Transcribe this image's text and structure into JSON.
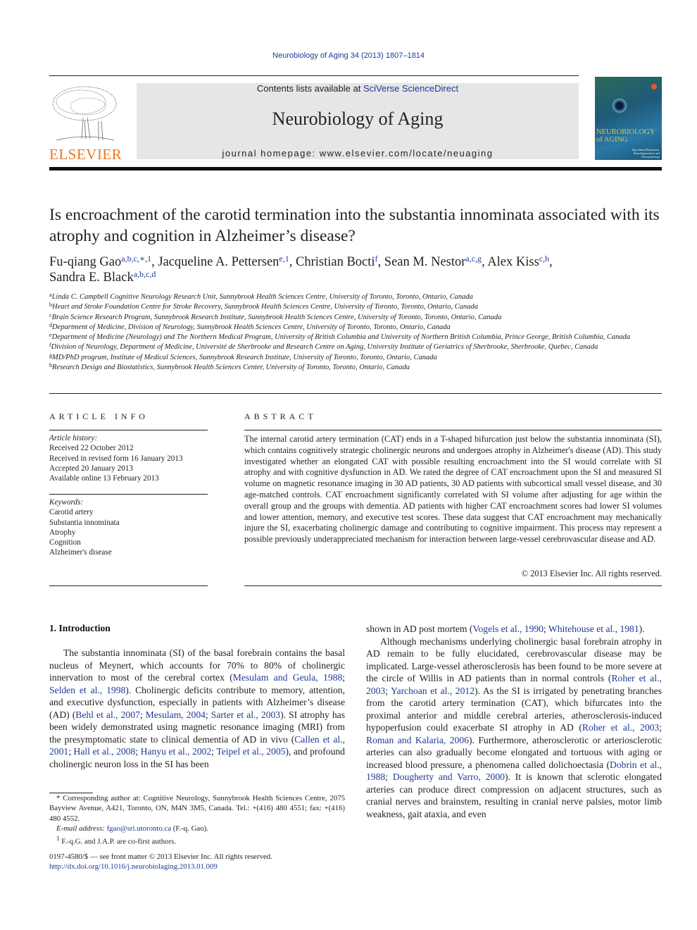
{
  "header": {
    "running_head": "Neurobiology of Aging 34 (2013) 1807–1814",
    "contents_prefix": "Contents lists available at ",
    "contents_link": "SciVerse ScienceDirect",
    "journal_title": "Neurobiology of Aging",
    "homepage": "journal homepage: www.elsevier.com/locate/neuaging",
    "publisher_logo_text": "ELSEVIER",
    "cover_title_line1": "NEUROBIOLOGY",
    "cover_title_line2": "of AGING",
    "cover_subtitle": "Age-related Phenomena, Neurodegeneration and Neuropathology"
  },
  "article": {
    "title": "Is encroachment of the carotid termination into the substantia innominata associated with its atrophy and cognition in Alzheimer’s disease?",
    "authors": [
      {
        "name": "Fu-qiang Gao",
        "sup": "a,b,c,∗,1",
        "sep": ", "
      },
      {
        "name": "Jacqueline A. Pettersen",
        "sup": "e,1",
        "sep": ", "
      },
      {
        "name": "Christian Bocti",
        "sup": "f",
        "sep": ", "
      },
      {
        "name": "Sean M. Nestor",
        "sup": "a,c,g",
        "sep": ", "
      },
      {
        "name": "Alex Kiss",
        "sup": "c,h",
        "sep": ","
      },
      {
        "name": "Sandra E. Black",
        "sup": "a,b,c,d",
        "sep": ""
      }
    ],
    "affiliations": [
      {
        "key": "a",
        "text": "Linda C. Campbell Cognitive Neurology Research Unit, Sunnybrook Health Sciences Centre, University of Toronto, Toronto, Ontario, Canada"
      },
      {
        "key": "b",
        "text": "Heart and Stroke Foundation Centre for Stroke Recovery, Sunnybrook Health Sciences Centre, University of Toronto, Toronto, Ontario, Canada"
      },
      {
        "key": "c",
        "text": "Brain Science Research Program, Sunnybrook Research Institute, Sunnybrook Health Sciences Centre, University of Toronto, Toronto, Ontario, Canada"
      },
      {
        "key": "d",
        "text": "Department of Medicine, Division of Neurology, Sunnybrook Health Sciences Centre, University of Toronto, Toronto, Ontario, Canada"
      },
      {
        "key": "e",
        "text": "Department of Medicine (Neurology) and The Northern Medical Program, University of British Columbia and University of Northern British Columbia, Prince George, British Columbia, Canada"
      },
      {
        "key": "f",
        "text": "Division of Neurology, Department of Medicine, Université de Sherbrooke and Research Centre on Aging, University Institute of Geriatrics of Sherbrooke, Sherbrooke, Quebec, Canada"
      },
      {
        "key": "g",
        "text": "MD/PhD program, Institute of Medical Sciences, Sunnybrook Research Institute, University of Toronto, Toronto, Ontario, Canada"
      },
      {
        "key": "h",
        "text": "Research Design and Biostatistics, Sunnybrook Health Sciences Center, University of Toronto, Toronto, Ontario, Canada"
      }
    ]
  },
  "article_info": {
    "heading": "ARTICLE INFO",
    "history_label": "Article history:",
    "history": [
      "Received 22 October 2012",
      "Received in revised form 16 January 2013",
      "Accepted 20 January 2013",
      "Available online 13 February 2013"
    ],
    "keywords_label": "Keywords:",
    "keywords": [
      "Carotid artery",
      "Substantia innominata",
      "Atrophy",
      "Cognition",
      "Alzheimer's disease"
    ]
  },
  "abstract": {
    "heading": "ABSTRACT",
    "text": "The internal carotid artery termination (CAT) ends in a T-shaped bifurcation just below the substantia innominata (SI), which contains cognitively strategic cholinergic neurons and undergoes atrophy in Alzheimer's disease (AD). This study investigated whether an elongated CAT with possible resulting encroachment into the SI would correlate with SI atrophy and with cognitive dysfunction in AD. We rated the degree of CAT encroachment upon the SI and measured SI volume on magnetic resonance imaging in 30 AD patients, 30 AD patients with subcortical small vessel disease, and 30 age-matched controls. CAT encroachment significantly correlated with SI volume after adjusting for age within the overall group and the groups with dementia. AD patients with higher CAT encroachment scores had lower SI volumes and lower attention, memory, and executive test scores. These data suggest that CAT encroachment may mechanically injure the SI, exacerbating cholinergic damage and contributing to cognitive impairment. This process may represent a possible previously underappreciated mechanism for interaction between large-vessel cerebrovascular disease and AD.",
    "copyright": "© 2013 Elsevier Inc. All rights reserved."
  },
  "introduction": {
    "heading": "1.  Introduction",
    "left_paragraph": [
      {
        "t": "The substantia innominata (SI) of the basal forebrain contains the basal nucleus of Meynert, which accounts for 70% to 80% of cholinergic innervation to most of the cerebral cortex ("
      },
      {
        "l": "Mesulam and Geula, 1988"
      },
      {
        "t": "; "
      },
      {
        "l": "Selden et al., 1998"
      },
      {
        "t": "). Cholinergic deficits contribute to memory, attention, and executive dysfunction, especially in patients with Alzheimer’s disease (AD) ("
      },
      {
        "l": "Behl et al., 2007"
      },
      {
        "t": "; "
      },
      {
        "l": "Mesulam, 2004"
      },
      {
        "t": "; "
      },
      {
        "l": "Sarter et al., 2003"
      },
      {
        "t": "). SI atrophy has been widely demonstrated using magnetic resonance imaging (MRI) from the presymptomatic state to clinical dementia of AD in vivo ("
      },
      {
        "l": "Callen et al., 2001"
      },
      {
        "t": "; "
      },
      {
        "l": "Hall et al., 2008"
      },
      {
        "t": "; "
      },
      {
        "l": "Hanyu et al., 2002"
      },
      {
        "t": "; "
      },
      {
        "l": "Teipel et al., 2005"
      },
      {
        "t": "), and profound cholinergic neuron loss in the SI has been"
      }
    ],
    "right_paragraph_1": [
      {
        "t": "shown in AD post mortem ("
      },
      {
        "l": "Vogels et al., 1990"
      },
      {
        "t": "; "
      },
      {
        "l": "Whitehouse et al., 1981"
      },
      {
        "t": ")."
      }
    ],
    "right_paragraph_2": [
      {
        "t": "Although mechanisms underlying cholinergic basal forebrain atrophy in AD remain to be fully elucidated, cerebrovascular disease may be implicated. Large-vessel atherosclerosis has been found to be more severe at the circle of Willis in AD patients than in normal controls ("
      },
      {
        "l": "Roher et al., 2003"
      },
      {
        "t": "; "
      },
      {
        "l": "Yarchoan et al., 2012"
      },
      {
        "t": "). As the SI is irrigated by penetrating branches from the carotid artery termination (CAT), which bifurcates into the proximal anterior and middle cerebral arteries, atherosclerosis-induced hypoperfusion could exacerbate SI atrophy in AD ("
      },
      {
        "l": "Roher et al., 2003"
      },
      {
        "t": "; "
      },
      {
        "l": "Roman and Kalaria, 2006"
      },
      {
        "t": "). Furthermore, atherosclerotic or arteriosclerotic arteries can also gradually become elongated and tortuous with aging or increased blood pressure, a phenomena called dolichoectasia ("
      },
      {
        "l": "Dobrin et al., 1988"
      },
      {
        "t": "; "
      },
      {
        "l": "Dougherty and Varro, 2000"
      },
      {
        "t": "). It is known that sclerotic elongated arteries can produce direct compression on adjacent structures, such as cranial nerves and brainstem, resulting in cranial nerve palsies, motor limb weakness, gait ataxia, and even"
      }
    ]
  },
  "footnotes": {
    "corresponding": "* Corresponding author at: Cognitive Neurology, Sunnybrook Health Sciences Centre, 2075 Bayview Avenue, A421, Toronto, ON, M4N 3M5, Canada. Tel.: +(416) 480 4551; fax: +(416) 480 4552.",
    "email_label": "E-mail address: ",
    "email": "fgao@sri.utoronto.ca",
    "email_suffix": " (F.-q. Gao).",
    "cofirst_mark": "1",
    "cofirst": "F.-q.G. and J.A.P. are co-first authors.",
    "front_matter": "0197-4580/$ — see front matter © 2013 Elsevier Inc. All rights reserved.",
    "doi": "http://dx.doi.org/10.1016/j.neurobiolaging.2013.01.009"
  }
}
